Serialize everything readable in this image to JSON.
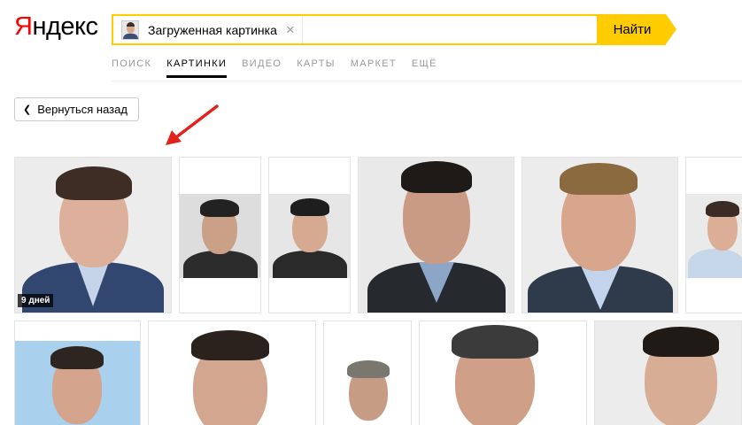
{
  "header": {
    "logo_first": "Я",
    "logo_rest": "ндекс",
    "search_chip_label": "Загруженная картинка",
    "clear_icon": "×",
    "find_button": "Найти"
  },
  "nav": [
    {
      "label": "Поиск",
      "active": false
    },
    {
      "label": "Картинки",
      "active": true
    },
    {
      "label": "Видео",
      "active": false
    },
    {
      "label": "Карты",
      "active": false
    },
    {
      "label": "Маркет",
      "active": false
    },
    {
      "label": "Ещё",
      "active": false
    }
  ],
  "back_button": "Вернуться назад",
  "results": {
    "first_badge": "9 дней"
  },
  "colors": {
    "accent": "#ffcc00",
    "logo_red": "#ff0000",
    "arrow": "#e0241b"
  },
  "icons": [
    "search-thumbnail-icon",
    "clear-icon",
    "chevron-left-icon",
    "arrow-pointer-icon"
  ]
}
